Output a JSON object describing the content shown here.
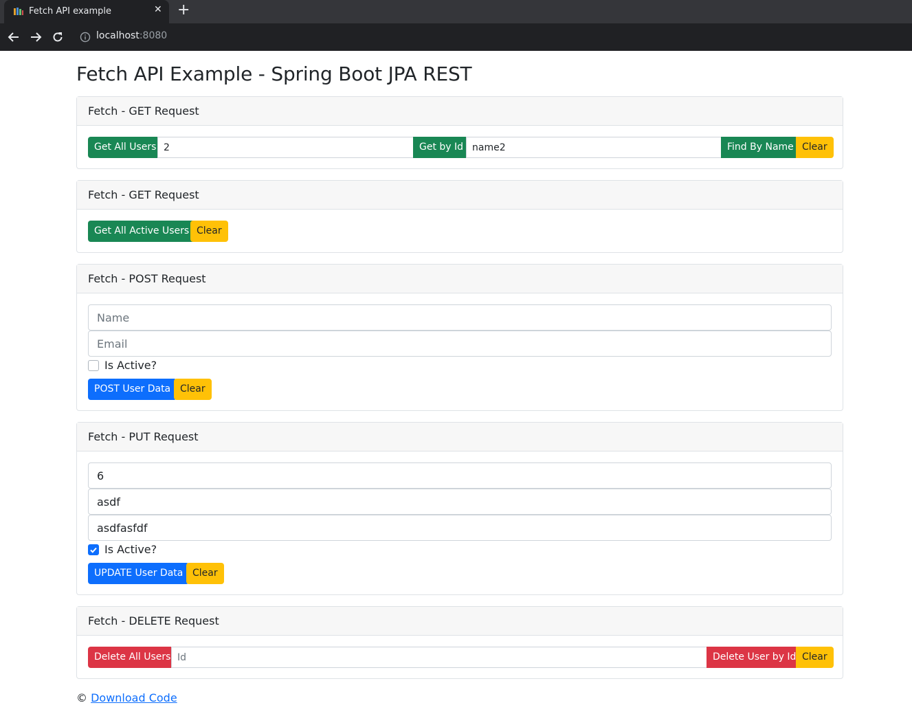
{
  "browser": {
    "tab_title": "Fetch API example",
    "tab_close": "✕",
    "new_tab": "+",
    "url_host": "localhost",
    "url_port": ":8080"
  },
  "page": {
    "title": "Fetch API Example - Spring Boot JPA REST"
  },
  "get_card": {
    "header": "Fetch - GET Request",
    "get_all_label": "Get All Users",
    "id_value": "2",
    "get_by_id_label": "Get by Id",
    "name_value": "name2",
    "find_by_name_label": "Find By Name",
    "clear_label": "Clear"
  },
  "get_active_card": {
    "header": "Fetch - GET Request",
    "get_all_active_label": "Get All Active Users",
    "clear_label": "Clear"
  },
  "post_card": {
    "header": "Fetch - POST Request",
    "name_placeholder": "Name",
    "email_placeholder": "Email",
    "is_active_label": "Is Active?",
    "is_active_checked": false,
    "submit_label": "POST User Data",
    "clear_label": "Clear"
  },
  "put_card": {
    "header": "Fetch - PUT Request",
    "id_value": "6",
    "name_value": "asdf",
    "email_value": "asdfasfdf",
    "is_active_label": "Is Active?",
    "is_active_checked": true,
    "submit_label": "UPDATE User Data",
    "clear_label": "Clear"
  },
  "delete_card": {
    "header": "Fetch - DELETE Request",
    "delete_all_label": "Delete All Users",
    "id_placeholder": "Id",
    "delete_by_id_label": "Delete User by Id",
    "clear_label": "Clear"
  },
  "footer": {
    "copyright": "© ",
    "link_label": "Download Code"
  },
  "colors": {
    "success": "#198754",
    "warning": "#ffc107",
    "primary": "#0d6efd",
    "danger": "#dc3545"
  }
}
